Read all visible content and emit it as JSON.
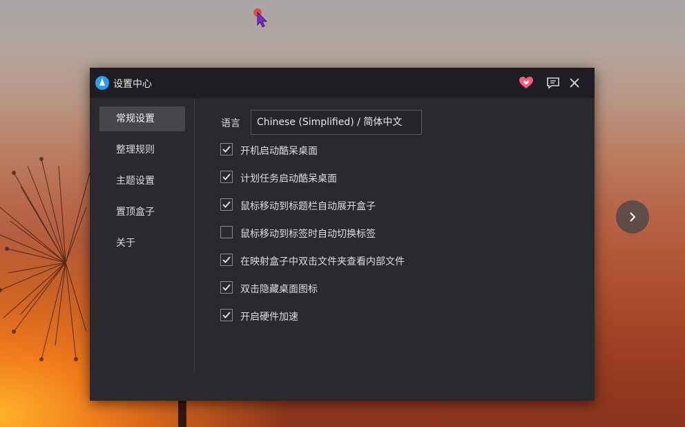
{
  "app": {
    "title": "设置中心"
  },
  "sidebar": {
    "items": [
      {
        "label": "常规设置",
        "active": true
      },
      {
        "label": "整理规则",
        "active": false
      },
      {
        "label": "主题设置",
        "active": false
      },
      {
        "label": "置顶盒子",
        "active": false
      },
      {
        "label": "关于",
        "active": false
      }
    ]
  },
  "general": {
    "language_label": "语言",
    "language_value": "Chinese (Simplified) / 简体中文",
    "options": [
      {
        "label": "开机启动酷呆桌面",
        "checked": true
      },
      {
        "label": "计划任务启动酷呆桌面",
        "checked": true
      },
      {
        "label": "鼠标移动到标题栏自动展开盒子",
        "checked": true
      },
      {
        "label": "鼠标移动到标签时自动切换标签",
        "checked": false
      },
      {
        "label": "在映射盒子中双击文件夹查看内部文件",
        "checked": true
      },
      {
        "label": "双击隐藏桌面图标",
        "checked": true
      },
      {
        "label": "开启硬件加速",
        "checked": true
      }
    ]
  },
  "icons": {
    "app": "app-logo-icon",
    "heart": "heart-icon",
    "feedback": "chat-bubble-icon",
    "close": "close-icon",
    "next": "chevron-right-icon",
    "cursor": "mouse-pointer-icon"
  },
  "colors": {
    "window_bg": "#2a2a2e",
    "titlebar_bg": "#1e1e22",
    "active_nav_bg": "#46464c",
    "heart": "#ff5a7a",
    "app_icon": "#2b9cf0"
  }
}
